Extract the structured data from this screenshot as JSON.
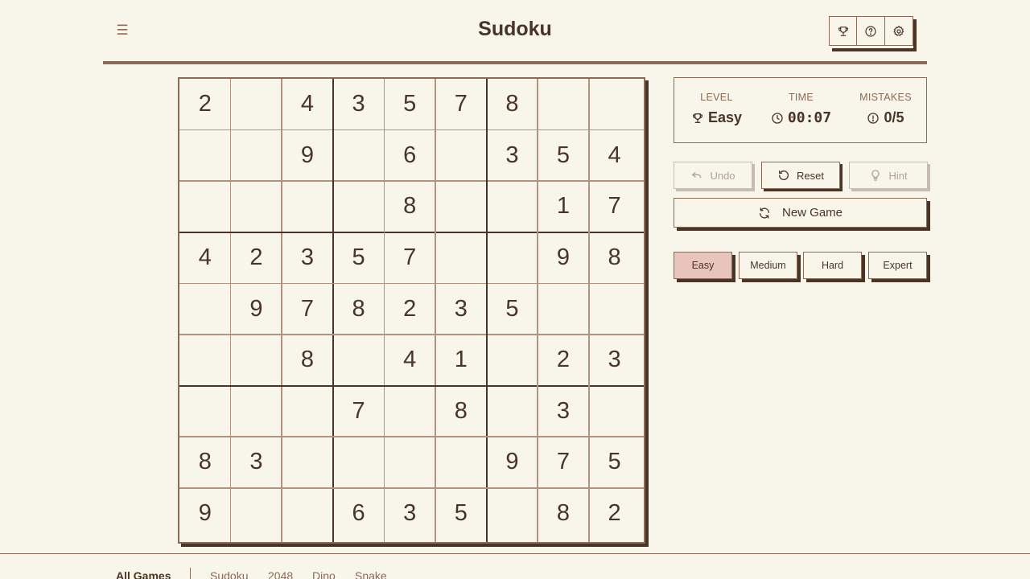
{
  "header": {
    "title": "Sudoku",
    "menu_glyph": "☰",
    "icons": [
      "trophy-icon",
      "help-icon",
      "settings-icon"
    ]
  },
  "board": [
    [
      2,
      0,
      4,
      3,
      5,
      7,
      8,
      0,
      0
    ],
    [
      0,
      0,
      9,
      0,
      6,
      0,
      3,
      5,
      4
    ],
    [
      0,
      0,
      0,
      0,
      8,
      0,
      0,
      1,
      7
    ],
    [
      4,
      2,
      3,
      5,
      7,
      0,
      0,
      9,
      8
    ],
    [
      0,
      9,
      7,
      8,
      2,
      3,
      5,
      0,
      0
    ],
    [
      0,
      0,
      8,
      0,
      4,
      1,
      0,
      2,
      3
    ],
    [
      0,
      0,
      0,
      7,
      0,
      8,
      0,
      3,
      0
    ],
    [
      8,
      3,
      0,
      0,
      0,
      0,
      9,
      7,
      5
    ],
    [
      9,
      0,
      0,
      6,
      3,
      5,
      0,
      8,
      2
    ]
  ],
  "stats": {
    "level_label": "LEVEL",
    "level_value": "Easy",
    "time_label": "TIME",
    "time_value": "00:07",
    "mistakes_label": "MISTAKES",
    "mistakes_value": "0/5"
  },
  "actions": {
    "undo": "Undo",
    "reset": "Reset",
    "hint": "Hint",
    "new_game": "New Game"
  },
  "difficulties": [
    "Easy",
    "Medium",
    "Hard",
    "Expert"
  ],
  "active_difficulty": "Easy",
  "footer": {
    "all_games": "All Games",
    "games": [
      "Sudoku",
      "2048",
      "Dino",
      "Snake"
    ]
  },
  "colors": {
    "background": "#f8f5ea",
    "ink": "#4a3427",
    "accent": "#8c6a54",
    "active_difficulty_bg": "#e8c4bd"
  }
}
